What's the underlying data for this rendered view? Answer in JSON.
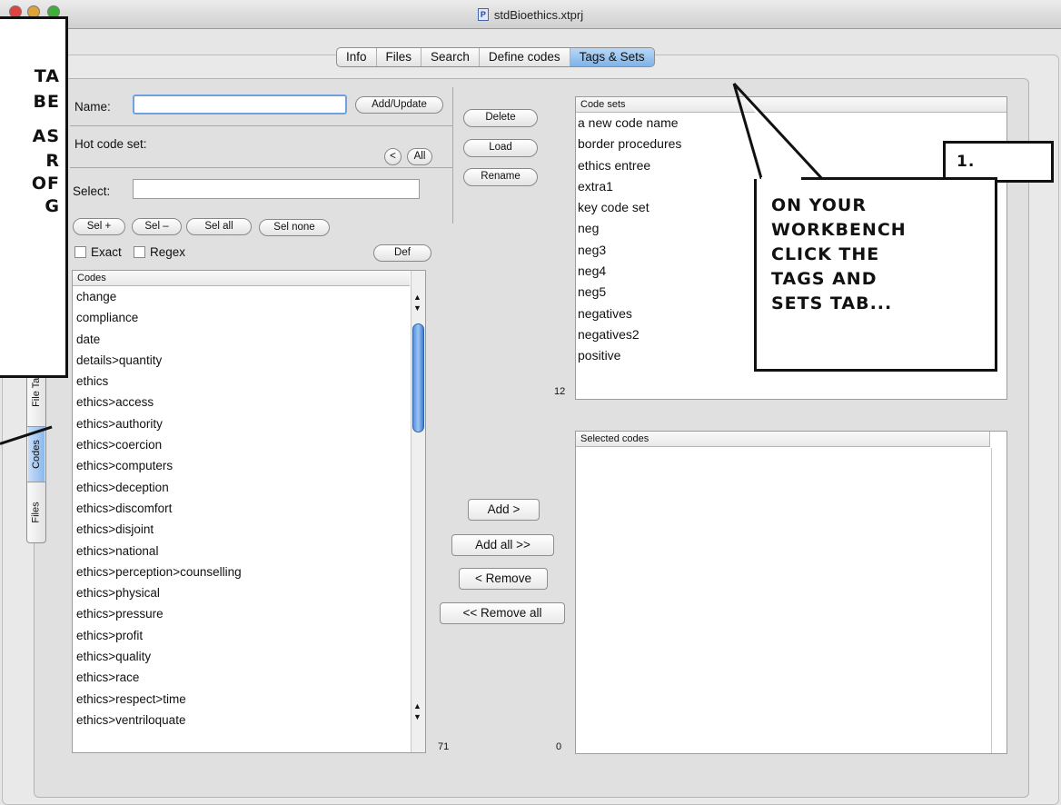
{
  "window": {
    "title": "stdBioethics.xtprj",
    "doc_icon": "P"
  },
  "tabs": [
    {
      "label": "Info"
    },
    {
      "label": "Files"
    },
    {
      "label": "Search"
    },
    {
      "label": "Define codes"
    },
    {
      "label": "Tags & Sets",
      "active": true
    }
  ],
  "left": {
    "name_label": "Name:",
    "name_value": "",
    "add_update": "Add/Update",
    "hot_code_set": "Hot code set:",
    "prev": "<",
    "all": "All",
    "select_label": "Select:",
    "select_value": "",
    "sel_plus": "Sel +",
    "sel_minus": "Sel –",
    "sel_all": "Sel all",
    "sel_none": "Sel none",
    "exact": "Exact",
    "regex": "Regex",
    "def": "Def",
    "codes_header": "Codes",
    "codes": [
      "change",
      "compliance",
      "date",
      "details>quantity",
      "ethics",
      "ethics>access",
      "ethics>authority",
      "ethics>coercion",
      "ethics>computers",
      "ethics>deception",
      "ethics>discomfort",
      "ethics>disjoint",
      "ethics>national",
      "ethics>perception>counselling",
      "ethics>physical",
      "ethics>pressure",
      "ethics>profit",
      "ethics>quality",
      "ethics>race",
      "ethics>respect>time",
      "ethics>ventriloquate"
    ],
    "codes_count": "71"
  },
  "middle": {
    "delete": "Delete",
    "load": "Load",
    "rename": "Rename",
    "add": "Add >",
    "add_all": "Add all >>",
    "remove": "< Remove",
    "remove_all": "<< Remove all",
    "sets_count": "12",
    "selected_count": "0"
  },
  "right": {
    "code_sets_header": "Code sets",
    "code_sets": [
      "a new code name",
      "border procedures",
      "ethics entree",
      "extra1",
      "key code set",
      "neg",
      "neg3",
      "neg4",
      "neg5",
      "negatives",
      "negatives2",
      "positive"
    ],
    "selected_header": "Selected codes"
  },
  "side_tabs": {
    "file_tags": "File Tags",
    "codes": "Codes",
    "files": "Files"
  },
  "callouts": {
    "left_fragments": [
      "TA",
      "BE",
      "AS",
      "R",
      "OF",
      "G"
    ],
    "number": "1.",
    "main": [
      "ON YOUR",
      "WORKBENCH",
      "CLICK THE",
      "TAGS AND",
      "SETS TAB..."
    ]
  }
}
